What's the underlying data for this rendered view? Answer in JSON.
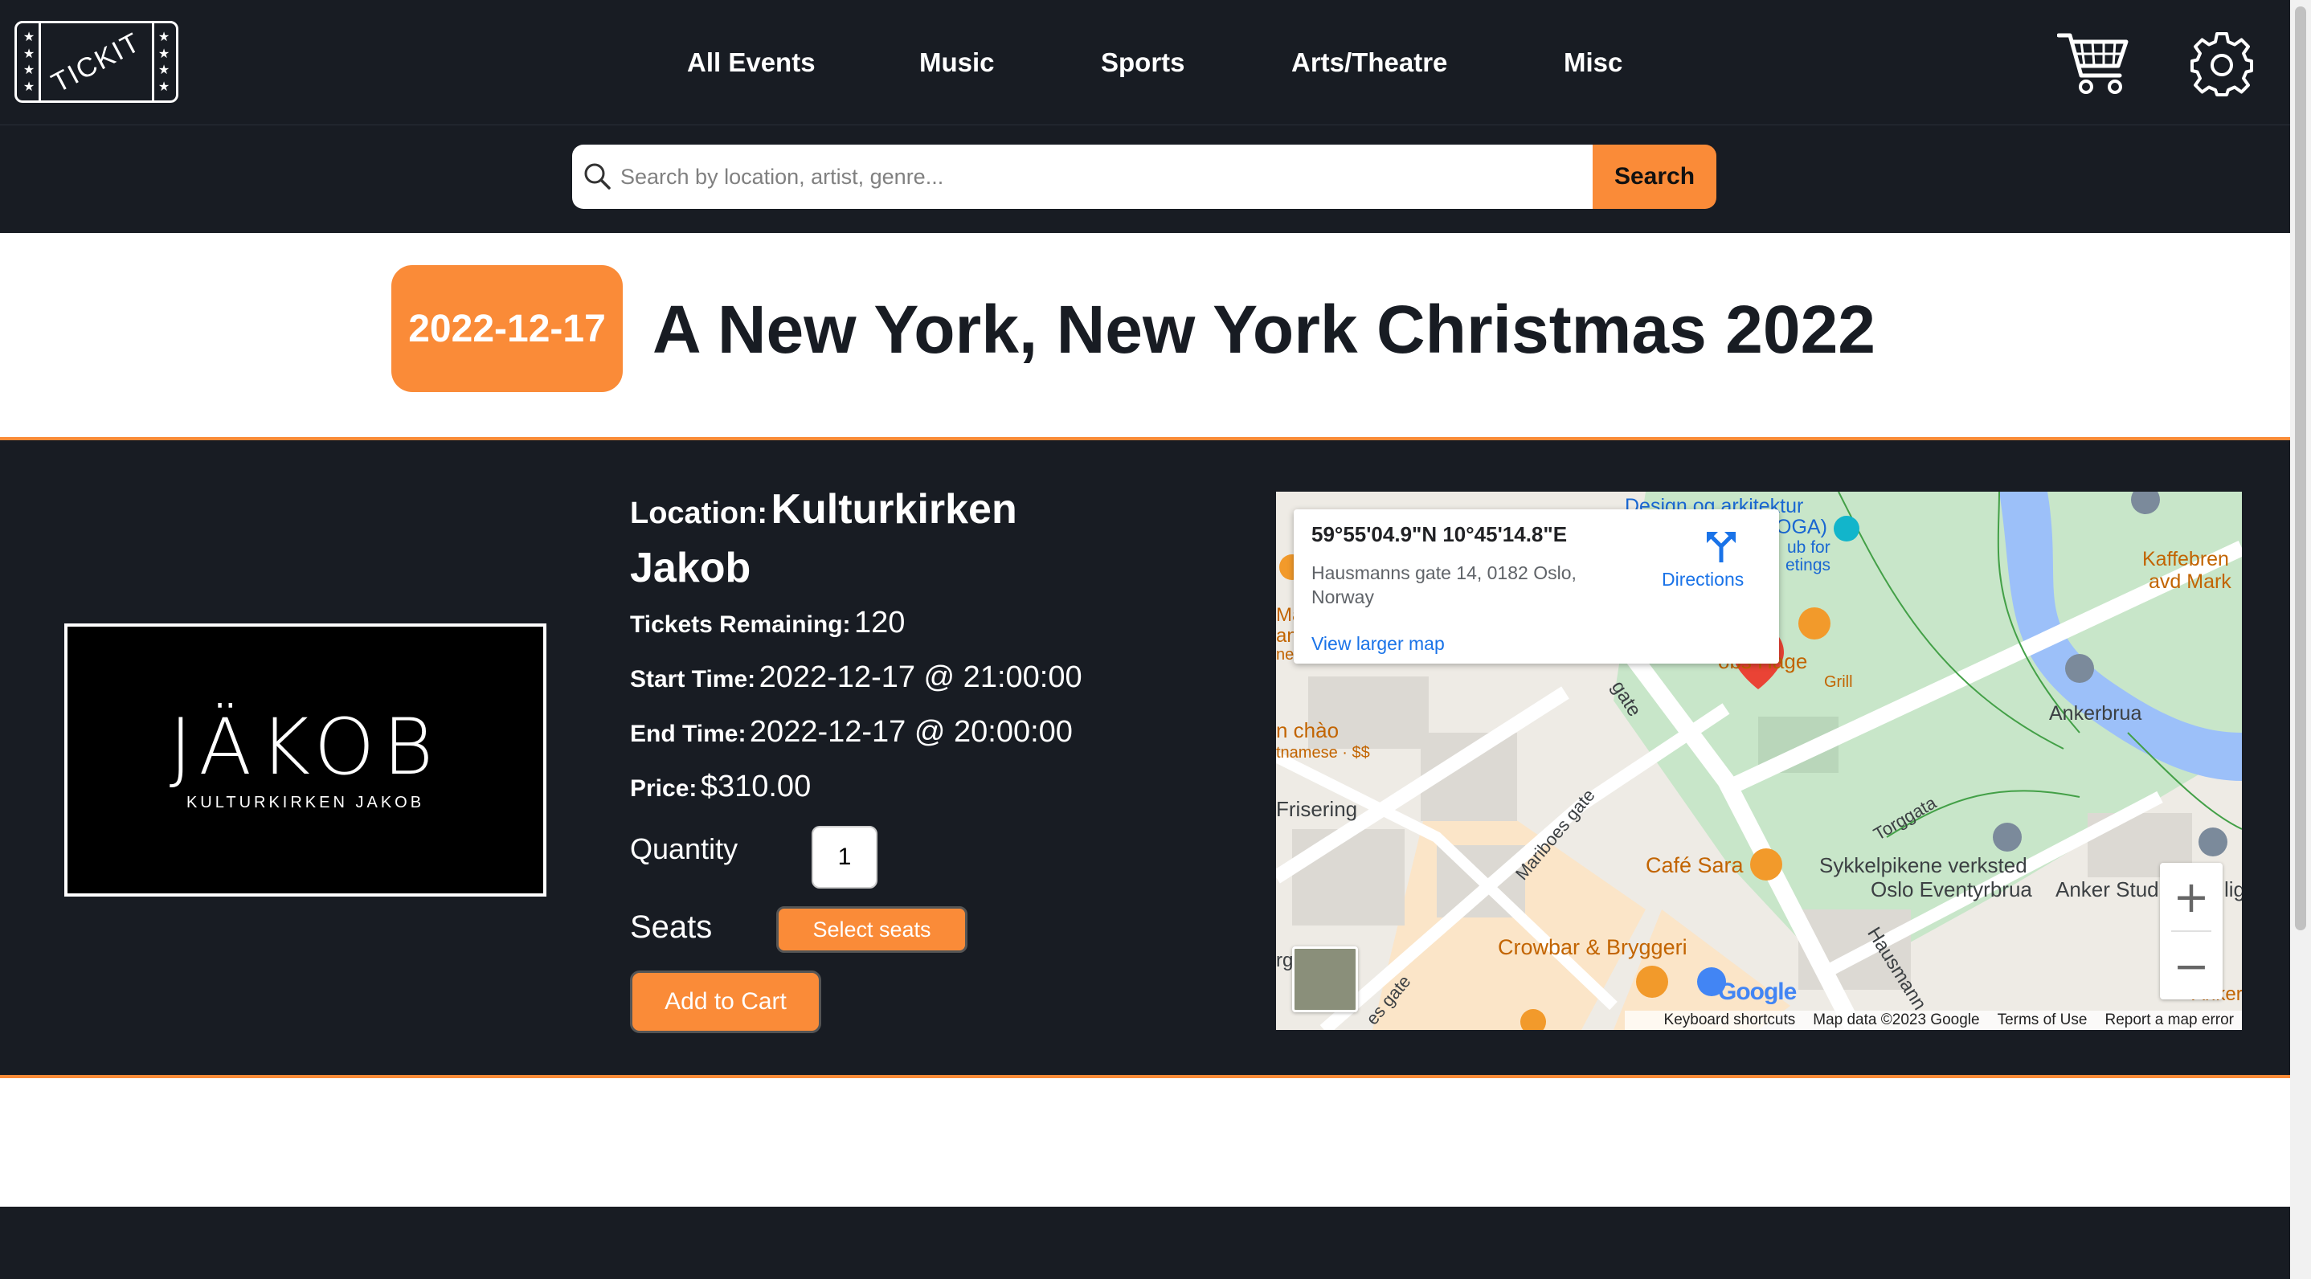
{
  "app": {
    "logo_text": "TICKIT",
    "accent_color": "#fa8b38",
    "dark_color": "#181c23"
  },
  "nav": {
    "items": [
      {
        "label": "All Events"
      },
      {
        "label": "Music"
      },
      {
        "label": "Sports"
      },
      {
        "label": "Arts/Theatre"
      },
      {
        "label": "Misc"
      }
    ],
    "icons": [
      "cart-icon",
      "gear-icon"
    ]
  },
  "search": {
    "placeholder": "Search by location, artist, genre...",
    "value": "",
    "button_label": "Search"
  },
  "event": {
    "date": "2022-12-17",
    "title": "A New York, New York Christmas 2022",
    "location_label": "Location:",
    "location": "Kulturkirken Jakob",
    "tickets_label": "Tickets Remaining:",
    "tickets": "120",
    "start_label": "Start Time:",
    "start": "2022-12-17 @ 21:00:00",
    "end_label": "End Time:",
    "end": "2022-12-17 @ 20:00:00",
    "price_label": "Price:",
    "price": "$310.00",
    "quantity_label": "Quantity",
    "quantity": "1",
    "seats_label": "Seats",
    "select_seats_label": "Select seats",
    "add_to_cart_label": "Add to Cart"
  },
  "venue_image": {
    "brand": "JÄKOB",
    "sub": "KULTURKIRKEN JAKOB"
  },
  "map": {
    "coords": "59°55'04.9\"N 10°45'14.8\"E",
    "address": "Hausmanns gate 14, 0182 Oslo, Norway",
    "directions_label": "Directions",
    "view_larger_label": "View larger map",
    "places": {
      "design": "Design og arkitektur",
      "oga": "OGA)",
      "hub_for": "ub for",
      "etings": "etings",
      "hage": "obs Hage",
      "grill": "Grill",
      "kaffebrenneriet": "Kaffebren",
      "avd_mark": "avd Mark",
      "ankerbrua": "Ankerbrua",
      "gate": "gate",
      "chao": "n chào",
      "namese": "tnamese · $$",
      "frisering": "Frisering",
      "mariboes": "Mariboes gate",
      "torggata": "Torggata",
      "cafe_sara": "Café Sara",
      "sykkelpikene": "Sykkelpikene verksted",
      "eventyrbrua": "Oslo Eventyrbrua",
      "anker_stud": "Anker Stud",
      "crowbar": "Crowbar & Bryggeri",
      "hausmann": "Hausmann",
      "es_gate": "es gate",
      "anker": "Anker",
      "ma": "Ma",
      "an": "an",
      "ne": "ne",
      "rg": "rg",
      "lig": "lig"
    },
    "google_logo": "Google",
    "footer": {
      "shortcuts": "Keyboard shortcuts",
      "data": "Map data ©2023 Google",
      "terms": "Terms of Use",
      "report": "Report a map error"
    },
    "zoom_in": "+",
    "zoom_out": "−"
  }
}
